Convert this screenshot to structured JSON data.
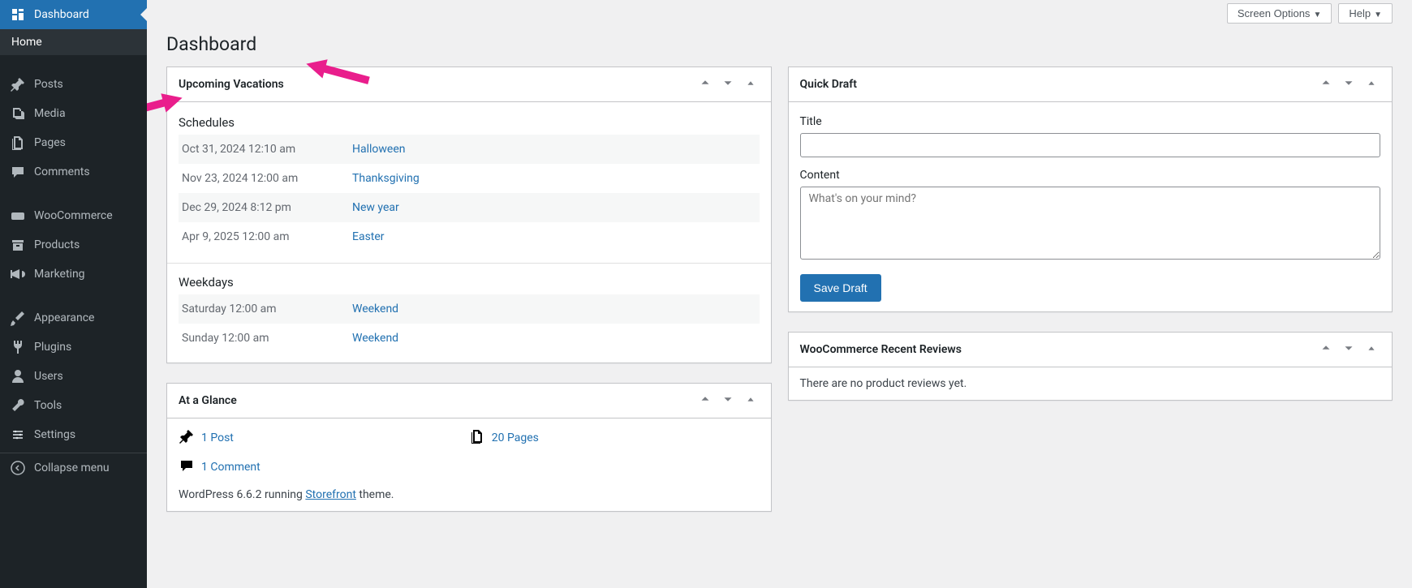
{
  "page_title": "Dashboard",
  "topbar": {
    "screen_options": "Screen Options",
    "help": "Help"
  },
  "sidebar": {
    "items": [
      {
        "label": "Dashboard",
        "icon": "dashboard",
        "current": true
      },
      {
        "label": "Posts",
        "icon": "pin"
      },
      {
        "label": "Media",
        "icon": "media"
      },
      {
        "label": "Pages",
        "icon": "pages"
      },
      {
        "label": "Comments",
        "icon": "comment"
      },
      {
        "label": "WooCommerce",
        "icon": "woo"
      },
      {
        "label": "Products",
        "icon": "archive"
      },
      {
        "label": "Marketing",
        "icon": "megaphone"
      },
      {
        "label": "Appearance",
        "icon": "brush"
      },
      {
        "label": "Plugins",
        "icon": "plug"
      },
      {
        "label": "Users",
        "icon": "user"
      },
      {
        "label": "Tools",
        "icon": "wrench"
      },
      {
        "label": "Settings",
        "icon": "settings"
      }
    ],
    "submenu_home": "Home",
    "collapse": "Collapse menu"
  },
  "upcoming_vacations": {
    "title": "Upcoming Vacations",
    "schedules_label": "Schedules",
    "schedules": [
      {
        "date": "Oct 31, 2024 12:10 am",
        "name": "Halloween"
      },
      {
        "date": "Nov 23, 2024 12:00 am",
        "name": "Thanksgiving"
      },
      {
        "date": "Dec 29, 2024 8:12 pm",
        "name": "New year"
      },
      {
        "date": "Apr 9, 2025 12:00 am",
        "name": "Easter"
      }
    ],
    "weekdays_label": "Weekdays",
    "weekdays": [
      {
        "date": "Saturday 12:00 am",
        "name": "Weekend"
      },
      {
        "date": "Sunday 12:00 am",
        "name": "Weekend"
      }
    ]
  },
  "at_a_glance": {
    "title": "At a Glance",
    "posts": "1 Post",
    "pages": "20 Pages",
    "comments": "1 Comment",
    "footer_pre": "WordPress 6.6.2 running ",
    "footer_link": "Storefront",
    "footer_post": " theme."
  },
  "quick_draft": {
    "title": "Quick Draft",
    "title_label": "Title",
    "content_label": "Content",
    "content_placeholder": "What's on your mind?",
    "save": "Save Draft"
  },
  "recent_reviews": {
    "title": "WooCommerce Recent Reviews",
    "empty": "There are no product reviews yet."
  },
  "annotation_color": "#e91e8c"
}
